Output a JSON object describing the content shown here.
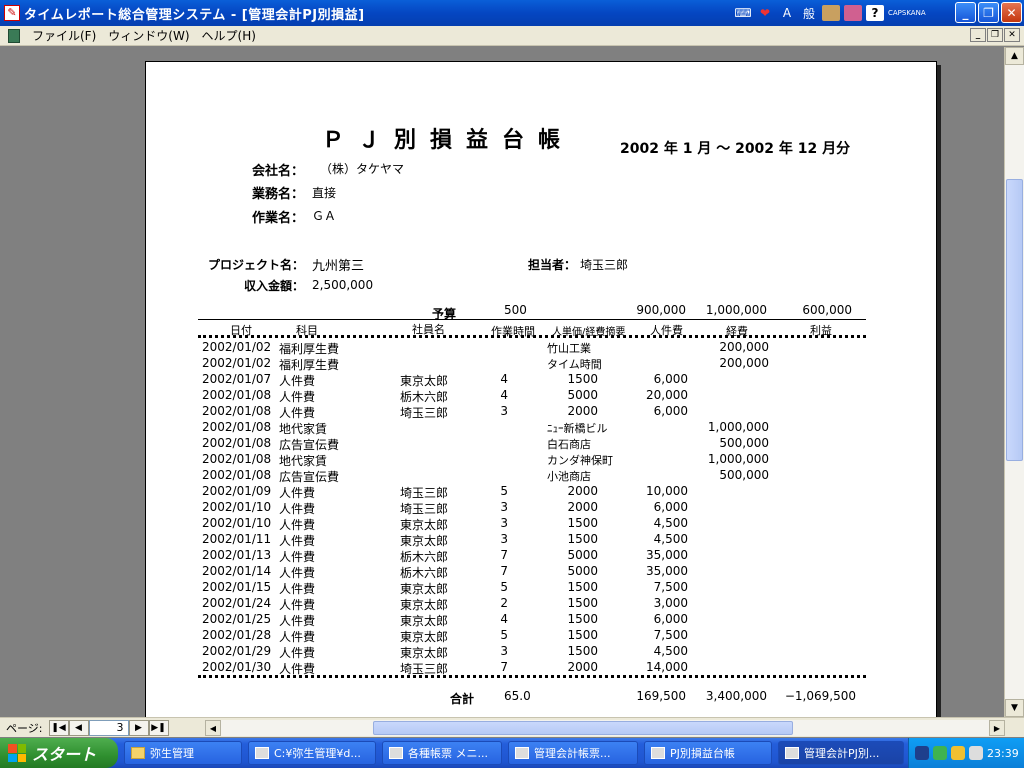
{
  "window": {
    "title": "タイムレポート総合管理システム - [管理会計PJ別損益]",
    "app_icon": "access-icon",
    "ime": {
      "mode": "A",
      "input": "般",
      "caps": "CAPS",
      "kana": "KANA"
    }
  },
  "menu": {
    "items": [
      "ファイル(F)",
      "ウィンドウ(W)",
      "ヘルプ(H)"
    ]
  },
  "report": {
    "title": "ＰＪ別損益台帳",
    "period": "2002 年  1 月 ～ 2002 年 12 月分",
    "company_label": "会社名：",
    "company_value": "（株）タケヤマ",
    "business_label": "業務名：",
    "business_value": "直接",
    "work_label": "作業名：",
    "work_value": "ＧＡ",
    "project_label": "プロジェクト名：",
    "project_value": "九州第三",
    "manager_label": "担当者：",
    "manager_value": "埼玉三郎",
    "income_label": "収入金額：",
    "income_value": "2,500,000",
    "budget": {
      "label": "予算",
      "hours": "500",
      "labor": "900,000",
      "expense": "1,000,000",
      "profit": "600,000"
    },
    "headers": {
      "date": "日付",
      "item": "科目",
      "employee": "社員名",
      "hours": "作業時間",
      "rate": "人単価/経費摘要",
      "labor": "人件費",
      "expense": "経費",
      "profit": "利益"
    },
    "rows": [
      {
        "date": "2002/01/02",
        "item": "福利厚生費",
        "employee": "",
        "hours": "",
        "rate": "竹山工業",
        "labor": "",
        "expense": "200,000"
      },
      {
        "date": "2002/01/02",
        "item": "福利厚生費",
        "employee": "",
        "hours": "",
        "rate": "タイム時間",
        "labor": "",
        "expense": "200,000"
      },
      {
        "date": "2002/01/07",
        "item": "人件費",
        "employee": "東京太郎",
        "hours": "4",
        "rate": "1500",
        "labor": "6,000",
        "expense": ""
      },
      {
        "date": "2002/01/08",
        "item": "人件費",
        "employee": "栃木六郎",
        "hours": "4",
        "rate": "5000",
        "labor": "20,000",
        "expense": ""
      },
      {
        "date": "2002/01/08",
        "item": "人件費",
        "employee": "埼玉三郎",
        "hours": "3",
        "rate": "2000",
        "labor": "6,000",
        "expense": ""
      },
      {
        "date": "2002/01/08",
        "item": "地代家賃",
        "employee": "",
        "hours": "",
        "rate": "ﾆｭｰ新橋ビル",
        "labor": "",
        "expense": "1,000,000"
      },
      {
        "date": "2002/01/08",
        "item": "広告宣伝費",
        "employee": "",
        "hours": "",
        "rate": "白石商店",
        "labor": "",
        "expense": "500,000"
      },
      {
        "date": "2002/01/08",
        "item": "地代家賃",
        "employee": "",
        "hours": "",
        "rate": "カンダ神保町",
        "labor": "",
        "expense": "1,000,000"
      },
      {
        "date": "2002/01/08",
        "item": "広告宣伝費",
        "employee": "",
        "hours": "",
        "rate": "小池商店",
        "labor": "",
        "expense": "500,000"
      },
      {
        "date": "2002/01/09",
        "item": "人件費",
        "employee": "埼玉三郎",
        "hours": "5",
        "rate": "2000",
        "labor": "10,000",
        "expense": ""
      },
      {
        "date": "2002/01/10",
        "item": "人件費",
        "employee": "埼玉三郎",
        "hours": "3",
        "rate": "2000",
        "labor": "6,000",
        "expense": ""
      },
      {
        "date": "2002/01/10",
        "item": "人件費",
        "employee": "東京太郎",
        "hours": "3",
        "rate": "1500",
        "labor": "4,500",
        "expense": ""
      },
      {
        "date": "2002/01/11",
        "item": "人件費",
        "employee": "東京太郎",
        "hours": "3",
        "rate": "1500",
        "labor": "4,500",
        "expense": ""
      },
      {
        "date": "2002/01/13",
        "item": "人件費",
        "employee": "栃木六郎",
        "hours": "7",
        "rate": "5000",
        "labor": "35,000",
        "expense": ""
      },
      {
        "date": "2002/01/14",
        "item": "人件費",
        "employee": "栃木六郎",
        "hours": "7",
        "rate": "5000",
        "labor": "35,000",
        "expense": ""
      },
      {
        "date": "2002/01/15",
        "item": "人件費",
        "employee": "東京太郎",
        "hours": "5",
        "rate": "1500",
        "labor": "7,500",
        "expense": ""
      },
      {
        "date": "2002/01/24",
        "item": "人件費",
        "employee": "東京太郎",
        "hours": "2",
        "rate": "1500",
        "labor": "3,000",
        "expense": ""
      },
      {
        "date": "2002/01/25",
        "item": "人件費",
        "employee": "東京太郎",
        "hours": "4",
        "rate": "1500",
        "labor": "6,000",
        "expense": ""
      },
      {
        "date": "2002/01/28",
        "item": "人件費",
        "employee": "東京太郎",
        "hours": "5",
        "rate": "1500",
        "labor": "7,500",
        "expense": ""
      },
      {
        "date": "2002/01/29",
        "item": "人件費",
        "employee": "東京太郎",
        "hours": "3",
        "rate": "1500",
        "labor": "4,500",
        "expense": ""
      },
      {
        "date": "2002/01/30",
        "item": "人件費",
        "employee": "埼玉三郎",
        "hours": "7",
        "rate": "2000",
        "labor": "14,000",
        "expense": ""
      }
    ],
    "total": {
      "label": "合計",
      "hours": "65.0",
      "labor": "169,500",
      "expense": "3,400,000",
      "profit": "−1,069,500"
    }
  },
  "navigation": {
    "page_label": "ページ:",
    "current_page": "3"
  },
  "taskbar": {
    "start_label": "スタート",
    "tasks": [
      {
        "label": "弥生管理",
        "icon": "folder-icon",
        "active": false
      },
      {
        "label": "C:¥弥生管理¥d...",
        "icon": "access-form-icon",
        "active": false
      },
      {
        "label": "各種帳票 メニ...",
        "icon": "access-form-icon",
        "active": false
      },
      {
        "label": "管理会計帳票...",
        "icon": "access-form-icon",
        "active": false
      },
      {
        "label": "PJ別損益台帳",
        "icon": "access-form-icon",
        "active": false
      },
      {
        "label": "管理会計PJ別...",
        "icon": "access-report-icon",
        "active": true
      }
    ],
    "clock": "23:39"
  }
}
